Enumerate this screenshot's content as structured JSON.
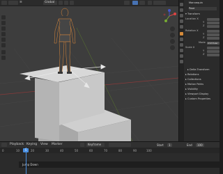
{
  "viewport": {
    "header": {
      "mode_label": "Global",
      "object_label": "Object"
    }
  },
  "properties": {
    "object_name": "Mannequin",
    "header_label": "Pose",
    "section_transform": "Transform",
    "rows": [
      {
        "label": "Location X"
      },
      {
        "label": "Y"
      },
      {
        "label": "Z"
      },
      {
        "label": "Rotation X"
      },
      {
        "label": "Y"
      },
      {
        "label": "Z"
      },
      {
        "label": "Mode"
      },
      {
        "label": "Scale X"
      },
      {
        "label": "Y"
      },
      {
        "label": "Z"
      }
    ],
    "mode_value": "XYZ Euler",
    "subsection_delta": "Delta Transform",
    "sections": [
      "Relations",
      "Collections",
      "Motion Paths",
      "Visibility",
      "Viewport Display",
      "Custom Properties"
    ]
  },
  "timeline": {
    "header_left": "Playback",
    "header_mid": "Keying",
    "header_right": "View",
    "header_marker": "Marker",
    "header_keyframe": "Keyframe",
    "ticks": [
      "0",
      "10",
      "20",
      "30",
      "40",
      "50",
      "60",
      "70",
      "80",
      "90",
      "100"
    ],
    "current_frame": "5",
    "track_label": "Jump Down",
    "start_label": "Start",
    "end_label": "End",
    "start_value": "1",
    "end_value": "100"
  }
}
